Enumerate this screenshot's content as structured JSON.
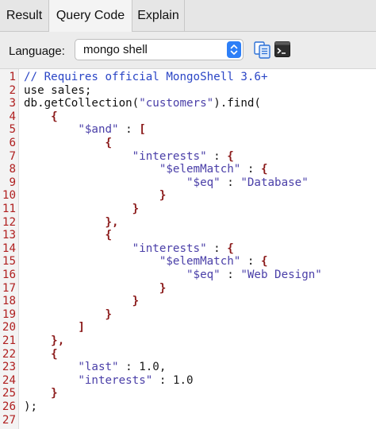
{
  "tabs": [
    {
      "label": "Result"
    },
    {
      "label": "Query Code",
      "active": true
    },
    {
      "label": "Explain"
    }
  ],
  "language": {
    "label": "Language:",
    "selected": "mongo shell"
  },
  "icons": {
    "copy": "copy-icon",
    "shell": "terminal-icon"
  },
  "colors": {
    "line_number": "#b02020",
    "comment": "#2b46c6",
    "string": "#4a3fa8",
    "bracket": "#8b1a1a",
    "select_accent": "#2d7ff7"
  },
  "code_lines": [
    {
      "n": "1",
      "tokens": [
        {
          "t": "// Requires official MongoShell 3.6+",
          "k": "comment"
        }
      ]
    },
    {
      "n": "2",
      "tokens": [
        {
          "t": "use sales;",
          "k": "plain"
        }
      ]
    },
    {
      "n": "3",
      "tokens": [
        {
          "t": "db.getCollection(",
          "k": "plain"
        },
        {
          "t": "\"customers\"",
          "k": "str"
        },
        {
          "t": ").find(",
          "k": "plain"
        }
      ]
    },
    {
      "n": "4",
      "tokens": [
        {
          "t": "    ",
          "k": "plain"
        },
        {
          "t": "{",
          "k": "punc"
        }
      ]
    },
    {
      "n": "5",
      "tokens": [
        {
          "t": "        ",
          "k": "plain"
        },
        {
          "t": "\"$and\"",
          "k": "str"
        },
        {
          "t": " : ",
          "k": "plain"
        },
        {
          "t": "[",
          "k": "punc"
        }
      ]
    },
    {
      "n": "6",
      "tokens": [
        {
          "t": "            ",
          "k": "plain"
        },
        {
          "t": "{",
          "k": "punc"
        }
      ]
    },
    {
      "n": "7",
      "tokens": [
        {
          "t": "                ",
          "k": "plain"
        },
        {
          "t": "\"interests\"",
          "k": "str"
        },
        {
          "t": " : ",
          "k": "plain"
        },
        {
          "t": "{",
          "k": "punc"
        }
      ]
    },
    {
      "n": "8",
      "tokens": [
        {
          "t": "                    ",
          "k": "plain"
        },
        {
          "t": "\"$elemMatch\"",
          "k": "str"
        },
        {
          "t": " : ",
          "k": "plain"
        },
        {
          "t": "{",
          "k": "punc"
        }
      ]
    },
    {
      "n": "9",
      "tokens": [
        {
          "t": "                        ",
          "k": "plain"
        },
        {
          "t": "\"$eq\"",
          "k": "str"
        },
        {
          "t": " : ",
          "k": "plain"
        },
        {
          "t": "\"Database\"",
          "k": "str"
        }
      ]
    },
    {
      "n": "10",
      "tokens": [
        {
          "t": "                    ",
          "k": "plain"
        },
        {
          "t": "}",
          "k": "punc"
        }
      ]
    },
    {
      "n": "11",
      "tokens": [
        {
          "t": "                ",
          "k": "plain"
        },
        {
          "t": "}",
          "k": "punc"
        }
      ]
    },
    {
      "n": "12",
      "tokens": [
        {
          "t": "            ",
          "k": "plain"
        },
        {
          "t": "},",
          "k": "punc"
        }
      ]
    },
    {
      "n": "13",
      "tokens": [
        {
          "t": "            ",
          "k": "plain"
        },
        {
          "t": "{",
          "k": "punc"
        }
      ]
    },
    {
      "n": "14",
      "tokens": [
        {
          "t": "                ",
          "k": "plain"
        },
        {
          "t": "\"interests\"",
          "k": "str"
        },
        {
          "t": " : ",
          "k": "plain"
        },
        {
          "t": "{",
          "k": "punc"
        }
      ]
    },
    {
      "n": "15",
      "tokens": [
        {
          "t": "                    ",
          "k": "plain"
        },
        {
          "t": "\"$elemMatch\"",
          "k": "str"
        },
        {
          "t": " : ",
          "k": "plain"
        },
        {
          "t": "{",
          "k": "punc"
        }
      ]
    },
    {
      "n": "16",
      "tokens": [
        {
          "t": "                        ",
          "k": "plain"
        },
        {
          "t": "\"$eq\"",
          "k": "str"
        },
        {
          "t": " : ",
          "k": "plain"
        },
        {
          "t": "\"Web Design\"",
          "k": "str"
        }
      ]
    },
    {
      "n": "17",
      "tokens": [
        {
          "t": "                    ",
          "k": "plain"
        },
        {
          "t": "}",
          "k": "punc"
        }
      ]
    },
    {
      "n": "18",
      "tokens": [
        {
          "t": "                ",
          "k": "plain"
        },
        {
          "t": "}",
          "k": "punc"
        }
      ]
    },
    {
      "n": "19",
      "tokens": [
        {
          "t": "            ",
          "k": "plain"
        },
        {
          "t": "}",
          "k": "punc"
        }
      ]
    },
    {
      "n": "20",
      "tokens": [
        {
          "t": "        ",
          "k": "plain"
        },
        {
          "t": "]",
          "k": "punc"
        }
      ]
    },
    {
      "n": "21",
      "tokens": [
        {
          "t": "    ",
          "k": "plain"
        },
        {
          "t": "},",
          "k": "punc"
        }
      ]
    },
    {
      "n": "22",
      "tokens": [
        {
          "t": "    ",
          "k": "plain"
        },
        {
          "t": "{",
          "k": "punc"
        }
      ]
    },
    {
      "n": "23",
      "tokens": [
        {
          "t": "        ",
          "k": "plain"
        },
        {
          "t": "\"last\"",
          "k": "str"
        },
        {
          "t": " : ",
          "k": "plain"
        },
        {
          "t": "1.0,",
          "k": "num"
        }
      ]
    },
    {
      "n": "24",
      "tokens": [
        {
          "t": "        ",
          "k": "plain"
        },
        {
          "t": "\"interests\"",
          "k": "str"
        },
        {
          "t": " : ",
          "k": "plain"
        },
        {
          "t": "1.0",
          "k": "num"
        }
      ]
    },
    {
      "n": "25",
      "tokens": [
        {
          "t": "    ",
          "k": "plain"
        },
        {
          "t": "}",
          "k": "punc"
        }
      ]
    },
    {
      "n": "26",
      "tokens": [
        {
          "t": ");",
          "k": "plain"
        }
      ]
    },
    {
      "n": "27",
      "tokens": []
    }
  ]
}
